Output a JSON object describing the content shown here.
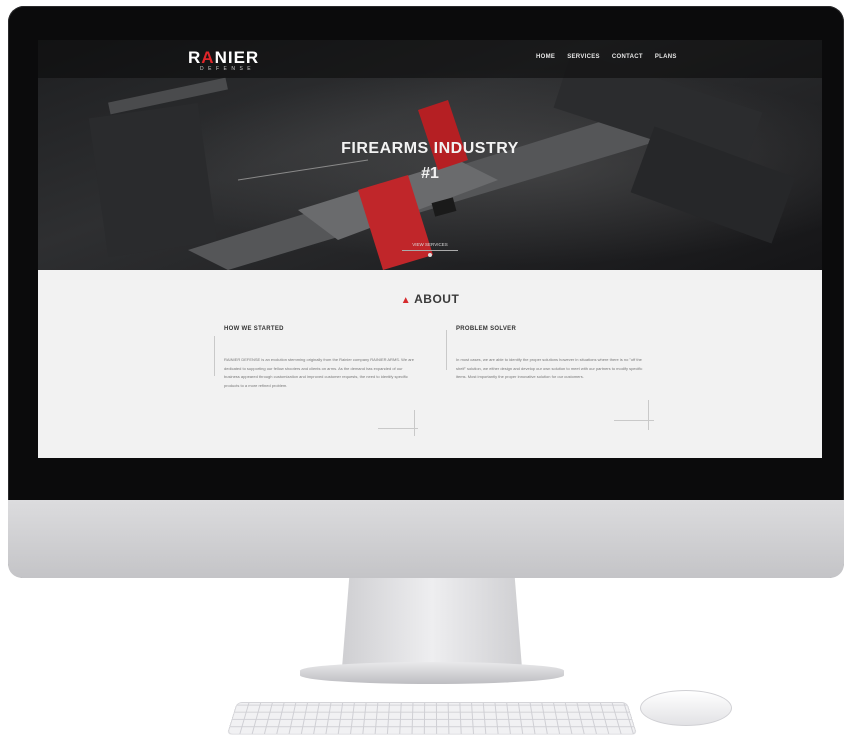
{
  "site": {
    "logo": {
      "main_left": "R",
      "main_mark": "A",
      "main_right": "NIER",
      "sub": "DEFENSE"
    },
    "nav": [
      "HOME",
      "SERVICES",
      "CONTACT",
      "PLANS"
    ],
    "hero": {
      "title": "FIREARMS INDUSTRY",
      "subtitle": "#1",
      "button": "VIEW SERVICES"
    },
    "about": {
      "title": "ABOUT",
      "left_heading": "HOW WE STARTED",
      "left_text": "RAINIER DEFENSE is an evolution stemming originally from the Rainier company RAINIER ARMS. We are dedicated to supporting our fellow shooters and clients on arms. As the demand has expanded of our business appeared through customization and improved customer requests, the need to identify specific products to a more refined problem.",
      "right_heading": "PROBLEM SOLVER",
      "right_text": "In most cases, we are able to identify the proper solutions however in situations where there is no \"off the shelf\" solution, we either design and develop our own solution to meet with our partners to modify specific items. Most importantly the proper innovative solution for our customers."
    }
  },
  "colors": {
    "accent": "#e0262a",
    "hero_bg": "#1e1f21",
    "page_bg": "#f2f2f2"
  },
  "icons": [
    "chevron-up-icon",
    "scroll-down-icon"
  ]
}
